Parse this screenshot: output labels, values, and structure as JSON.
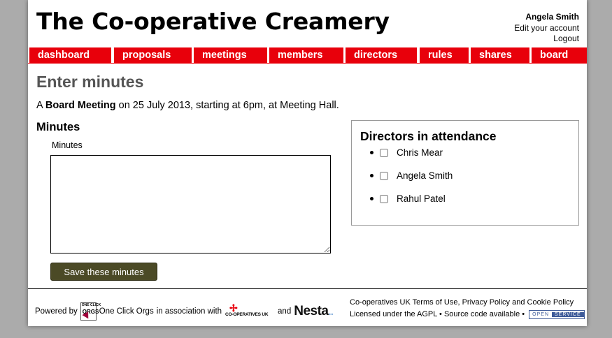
{
  "header": {
    "site_title": "The Co-operative Creamery",
    "user_name": "Angela Smith",
    "edit_account": "Edit your account",
    "logout": "Logout"
  },
  "nav": {
    "items": [
      {
        "label": "dashboard"
      },
      {
        "label": "proposals"
      },
      {
        "label": "meetings"
      },
      {
        "label": "members"
      },
      {
        "label": "directors"
      },
      {
        "label": "rules"
      },
      {
        "label": "shares"
      },
      {
        "label": "board"
      }
    ]
  },
  "main": {
    "heading": "Enter minutes",
    "intro_prefix": "A ",
    "meeting_type": "Board Meeting",
    "intro_suffix": " on 25 July 2013, starting at 6pm, at Meeting Hall.",
    "minutes_heading": "Minutes",
    "minutes_label": "Minutes",
    "minutes_value": "",
    "save_button": "Save these minutes"
  },
  "directors": {
    "heading": "Directors in attendance",
    "items": [
      {
        "name": "Chris Mear",
        "checked": false
      },
      {
        "name": "Angela Smith",
        "checked": false
      },
      {
        "name": "Rahul Patel",
        "checked": false
      }
    ]
  },
  "footer": {
    "powered_by": "Powered by",
    "oco_logo_top": "ONE CLICK",
    "oco_logo_main": "ORGS",
    "oco_name": "One Click Orgs",
    "association": "in association with",
    "coops_logo_text": "CO-OPERATIVES UK",
    "and": "and",
    "nesta": "Nesta",
    "terms_prefix": "Co-operatives UK ",
    "terms_link": "Terms of Use",
    "comma": ", ",
    "privacy_link": "Privacy Policy",
    "and_text": " and ",
    "cookie_link": "Cookie Policy",
    "license_prefix": "Licensed under the ",
    "agpl_link": "AGPL",
    "separator": " • ",
    "source_link": "Source code available",
    "separator2": " • ",
    "open_label": "OPEN",
    "service_label": "SERVICE"
  },
  "colors": {
    "nav_red": "#e8000b",
    "heading_grey": "#555555",
    "save_button_olive": "#4b4a26",
    "page_background": "#ababab"
  }
}
